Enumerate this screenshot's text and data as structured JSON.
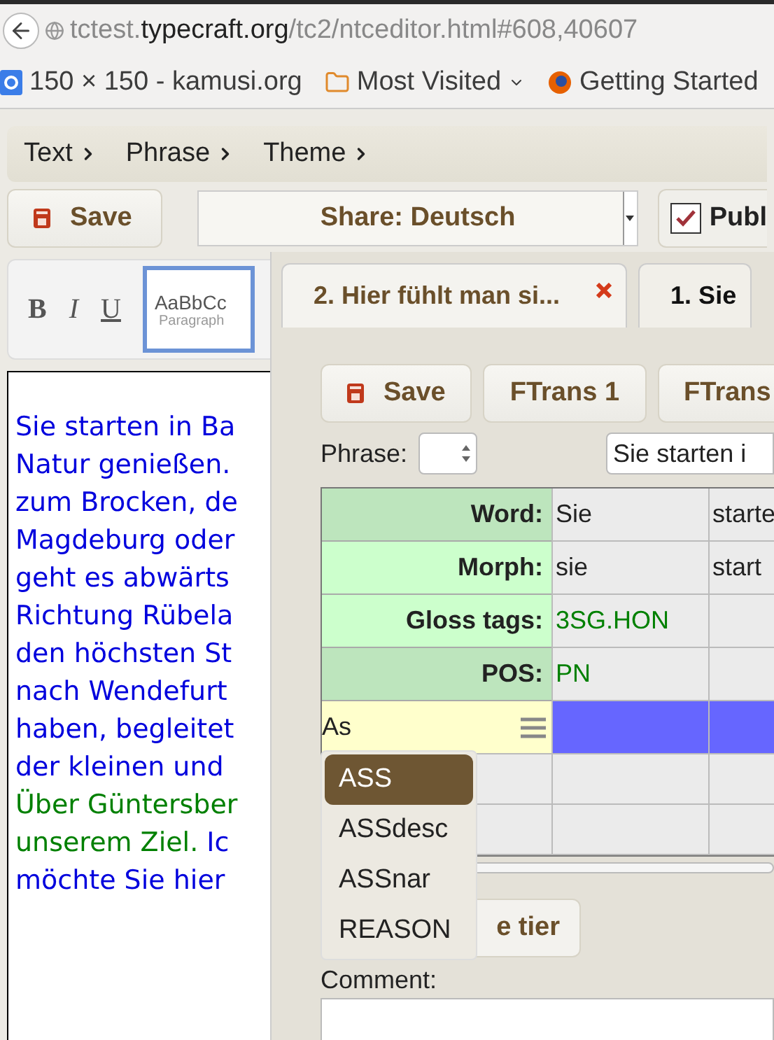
{
  "browser": {
    "url": {
      "subdomain": "tctest.",
      "domain": "typecraft.org",
      "path": "/tc2/ntceditor.html#608,40607"
    },
    "bookmarks": [
      {
        "kind": "site",
        "label": "150 × 150 - kamusi.org"
      },
      {
        "kind": "folder",
        "label": "Most Visited"
      },
      {
        "kind": "firefox",
        "label": "Getting Started"
      },
      {
        "kind": "cut"
      }
    ]
  },
  "menu": [
    "Text",
    "Phrase",
    "Theme"
  ],
  "toolbar": {
    "save": "Save",
    "share": "Share: Deutsch",
    "publish": {
      "label": "Publ",
      "checked": true
    }
  },
  "editor": {
    "format_buttons": [
      "B",
      "I",
      "U"
    ],
    "style_preview": {
      "sample": "AaBbCc",
      "name": "Paragraph",
      "selected": true
    },
    "lines": [
      [
        {
          "text": "Sie starten in Ba",
          "color": "#0000dd"
        }
      ],
      [
        {
          "text": "Natur genießen.",
          "color": "#0000dd"
        }
      ],
      [
        {
          "text": "zum Brocken, de",
          "color": "#0000dd"
        }
      ],
      [
        {
          "text": "Magdeburg oder",
          "color": "#0000dd"
        }
      ],
      [
        {
          "text": "geht es abwärts",
          "color": "#0000dd"
        }
      ],
      [
        {
          "text": "Richtung Rübela",
          "color": "#0000dd"
        }
      ],
      [
        {
          "text": "den höchsten St",
          "color": "#0000dd"
        }
      ],
      [
        {
          "text": "nach Wendefurt",
          "color": "#0000dd"
        }
      ],
      [
        {
          "text": "haben, begleitet",
          "color": "#0000dd"
        }
      ],
      [
        {
          "text": "der kleinen und",
          "color": "#0000dd"
        }
      ],
      [
        {
          "text": "Über Güntersber",
          "color": "#008000"
        }
      ],
      [
        {
          "text": "unserem Ziel.",
          "color": "#008000"
        },
        {
          "text": "Ic",
          "color": "#0000dd"
        }
      ],
      [
        {
          "text": "möchte Sie hier",
          "color": "#0000dd"
        }
      ]
    ]
  },
  "dialog": {
    "tabs": [
      {
        "label": "2. Hier fühlt man si...",
        "selected": false,
        "closable": true
      },
      {
        "label": "1. Sie",
        "selected": true,
        "closable": false
      }
    ],
    "buttons": [
      {
        "kind": "save",
        "label": "Save"
      },
      {
        "kind": "plain",
        "label": "FTrans 1"
      },
      {
        "kind": "plain",
        "label": "FTrans"
      }
    ],
    "phrase_label": "Phrase:",
    "phrase_text": "Sie starten i",
    "table": {
      "rows": [
        {
          "label": "Word:",
          "color": "#bde5bd",
          "cells": [
            {
              "text": "Sie",
              "color": "#222222"
            },
            {
              "text": "starte",
              "color": "#222222"
            }
          ]
        },
        {
          "label": "Morph:",
          "color": "#ccffcc",
          "cells": [
            {
              "text": "sie",
              "color": "#222222"
            },
            {
              "text": "start",
              "color": "#222222"
            }
          ]
        },
        {
          "label": "Gloss tags:",
          "color": "#ccffcc",
          "cells": [
            {
              "text": "3SG.HON",
              "color": "#008000"
            }
          ]
        },
        {
          "label": "POS:",
          "color": "#bde5bd",
          "cells": [
            {
              "text": "PN",
              "color": "#008000"
            }
          ]
        }
      ],
      "input": {
        "value": "As"
      }
    },
    "suggestions": [
      {
        "label": "ASS",
        "selected": true
      },
      {
        "label": "ASSdesc",
        "selected": false
      },
      {
        "label": "ASSnar",
        "selected": false
      },
      {
        "label": "REASON",
        "selected": false
      }
    ],
    "add_tier_button": "e tier",
    "comment_label": "Comment:"
  }
}
